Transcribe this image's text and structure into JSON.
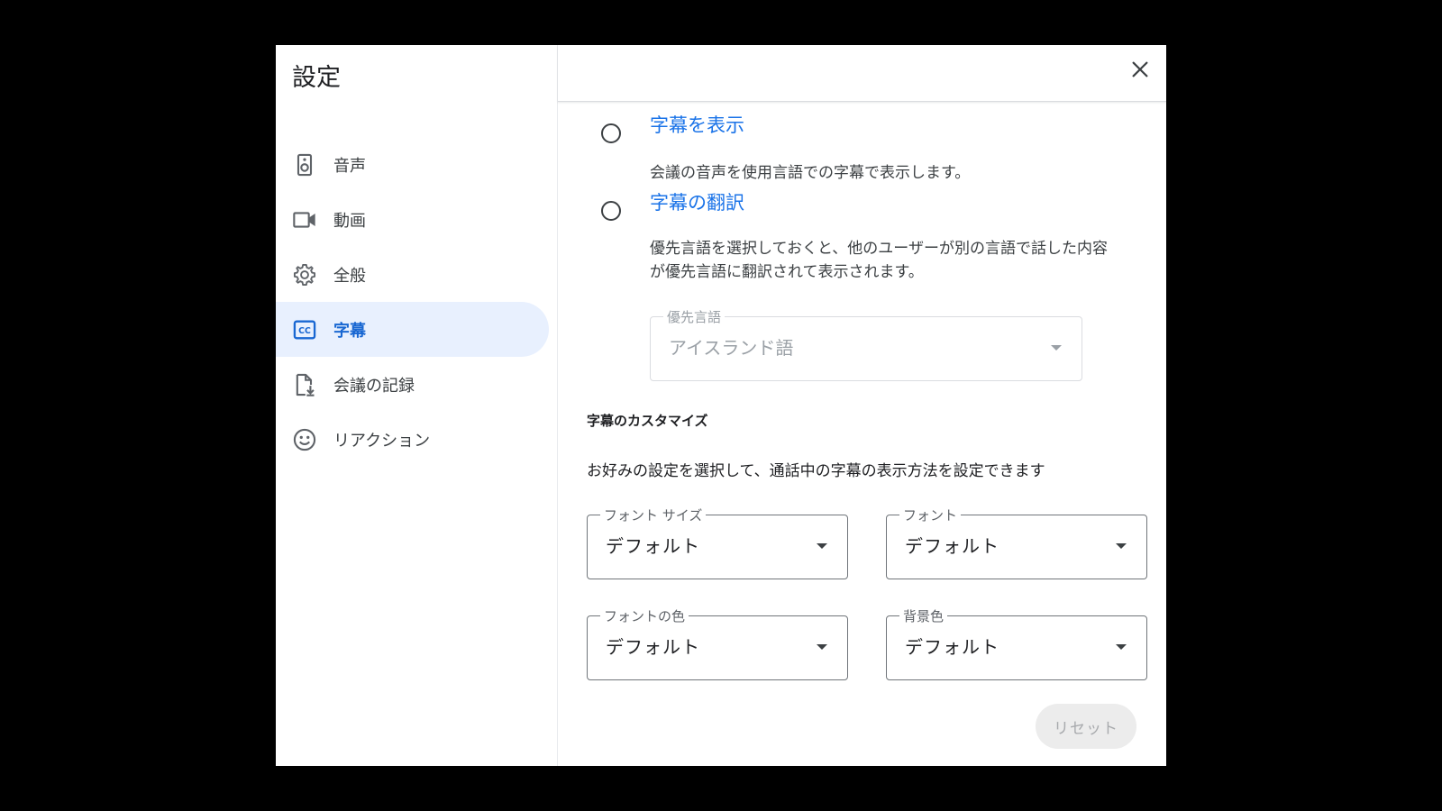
{
  "dialog": {
    "title": "設定",
    "close_icon": "close-icon"
  },
  "sidebar": {
    "items": [
      {
        "label": "音声",
        "icon": "speaker-icon",
        "active": false
      },
      {
        "label": "動画",
        "icon": "videocam-icon",
        "active": false
      },
      {
        "label": "全般",
        "icon": "gear-icon",
        "active": false
      },
      {
        "label": "字幕",
        "icon": "closed-caption-icon",
        "active": true
      },
      {
        "label": "会議の記録",
        "icon": "file-download-icon",
        "active": false
      },
      {
        "label": "リアクション",
        "icon": "smiley-icon",
        "active": false
      }
    ]
  },
  "captions": {
    "show_option": {
      "label": "字幕を表示",
      "description": "会議の音声を使用言語での字幕で表示します。",
      "selected": false
    },
    "translate_option": {
      "label": "字幕の翻訳",
      "description_line1": "優先言語を選択しておくと、他のユーザーが別の言語で話した内容",
      "description_line2": "が優先言語に翻訳されて表示されます。",
      "selected": false
    },
    "preferred_language": {
      "legend": "優先言語",
      "value": "アイスランド語",
      "disabled": true
    }
  },
  "customize": {
    "title": "字幕のカスタマイズ",
    "description": "お好みの設定を選択して、通話中の字幕の表示方法を設定できます",
    "font_size": {
      "legend": "フォント サイズ",
      "value": "デフォルト"
    },
    "font": {
      "legend": "フォント",
      "value": "デフォルト"
    },
    "font_color": {
      "legend": "フォントの色",
      "value": "デフォルト"
    },
    "background_color": {
      "legend": "背景色",
      "value": "デフォルト"
    },
    "reset_label": "リセット"
  },
  "colors": {
    "accent": "#1a73e8",
    "active_nav_bg": "#e8f0fe",
    "backdrop": "#000000"
  }
}
